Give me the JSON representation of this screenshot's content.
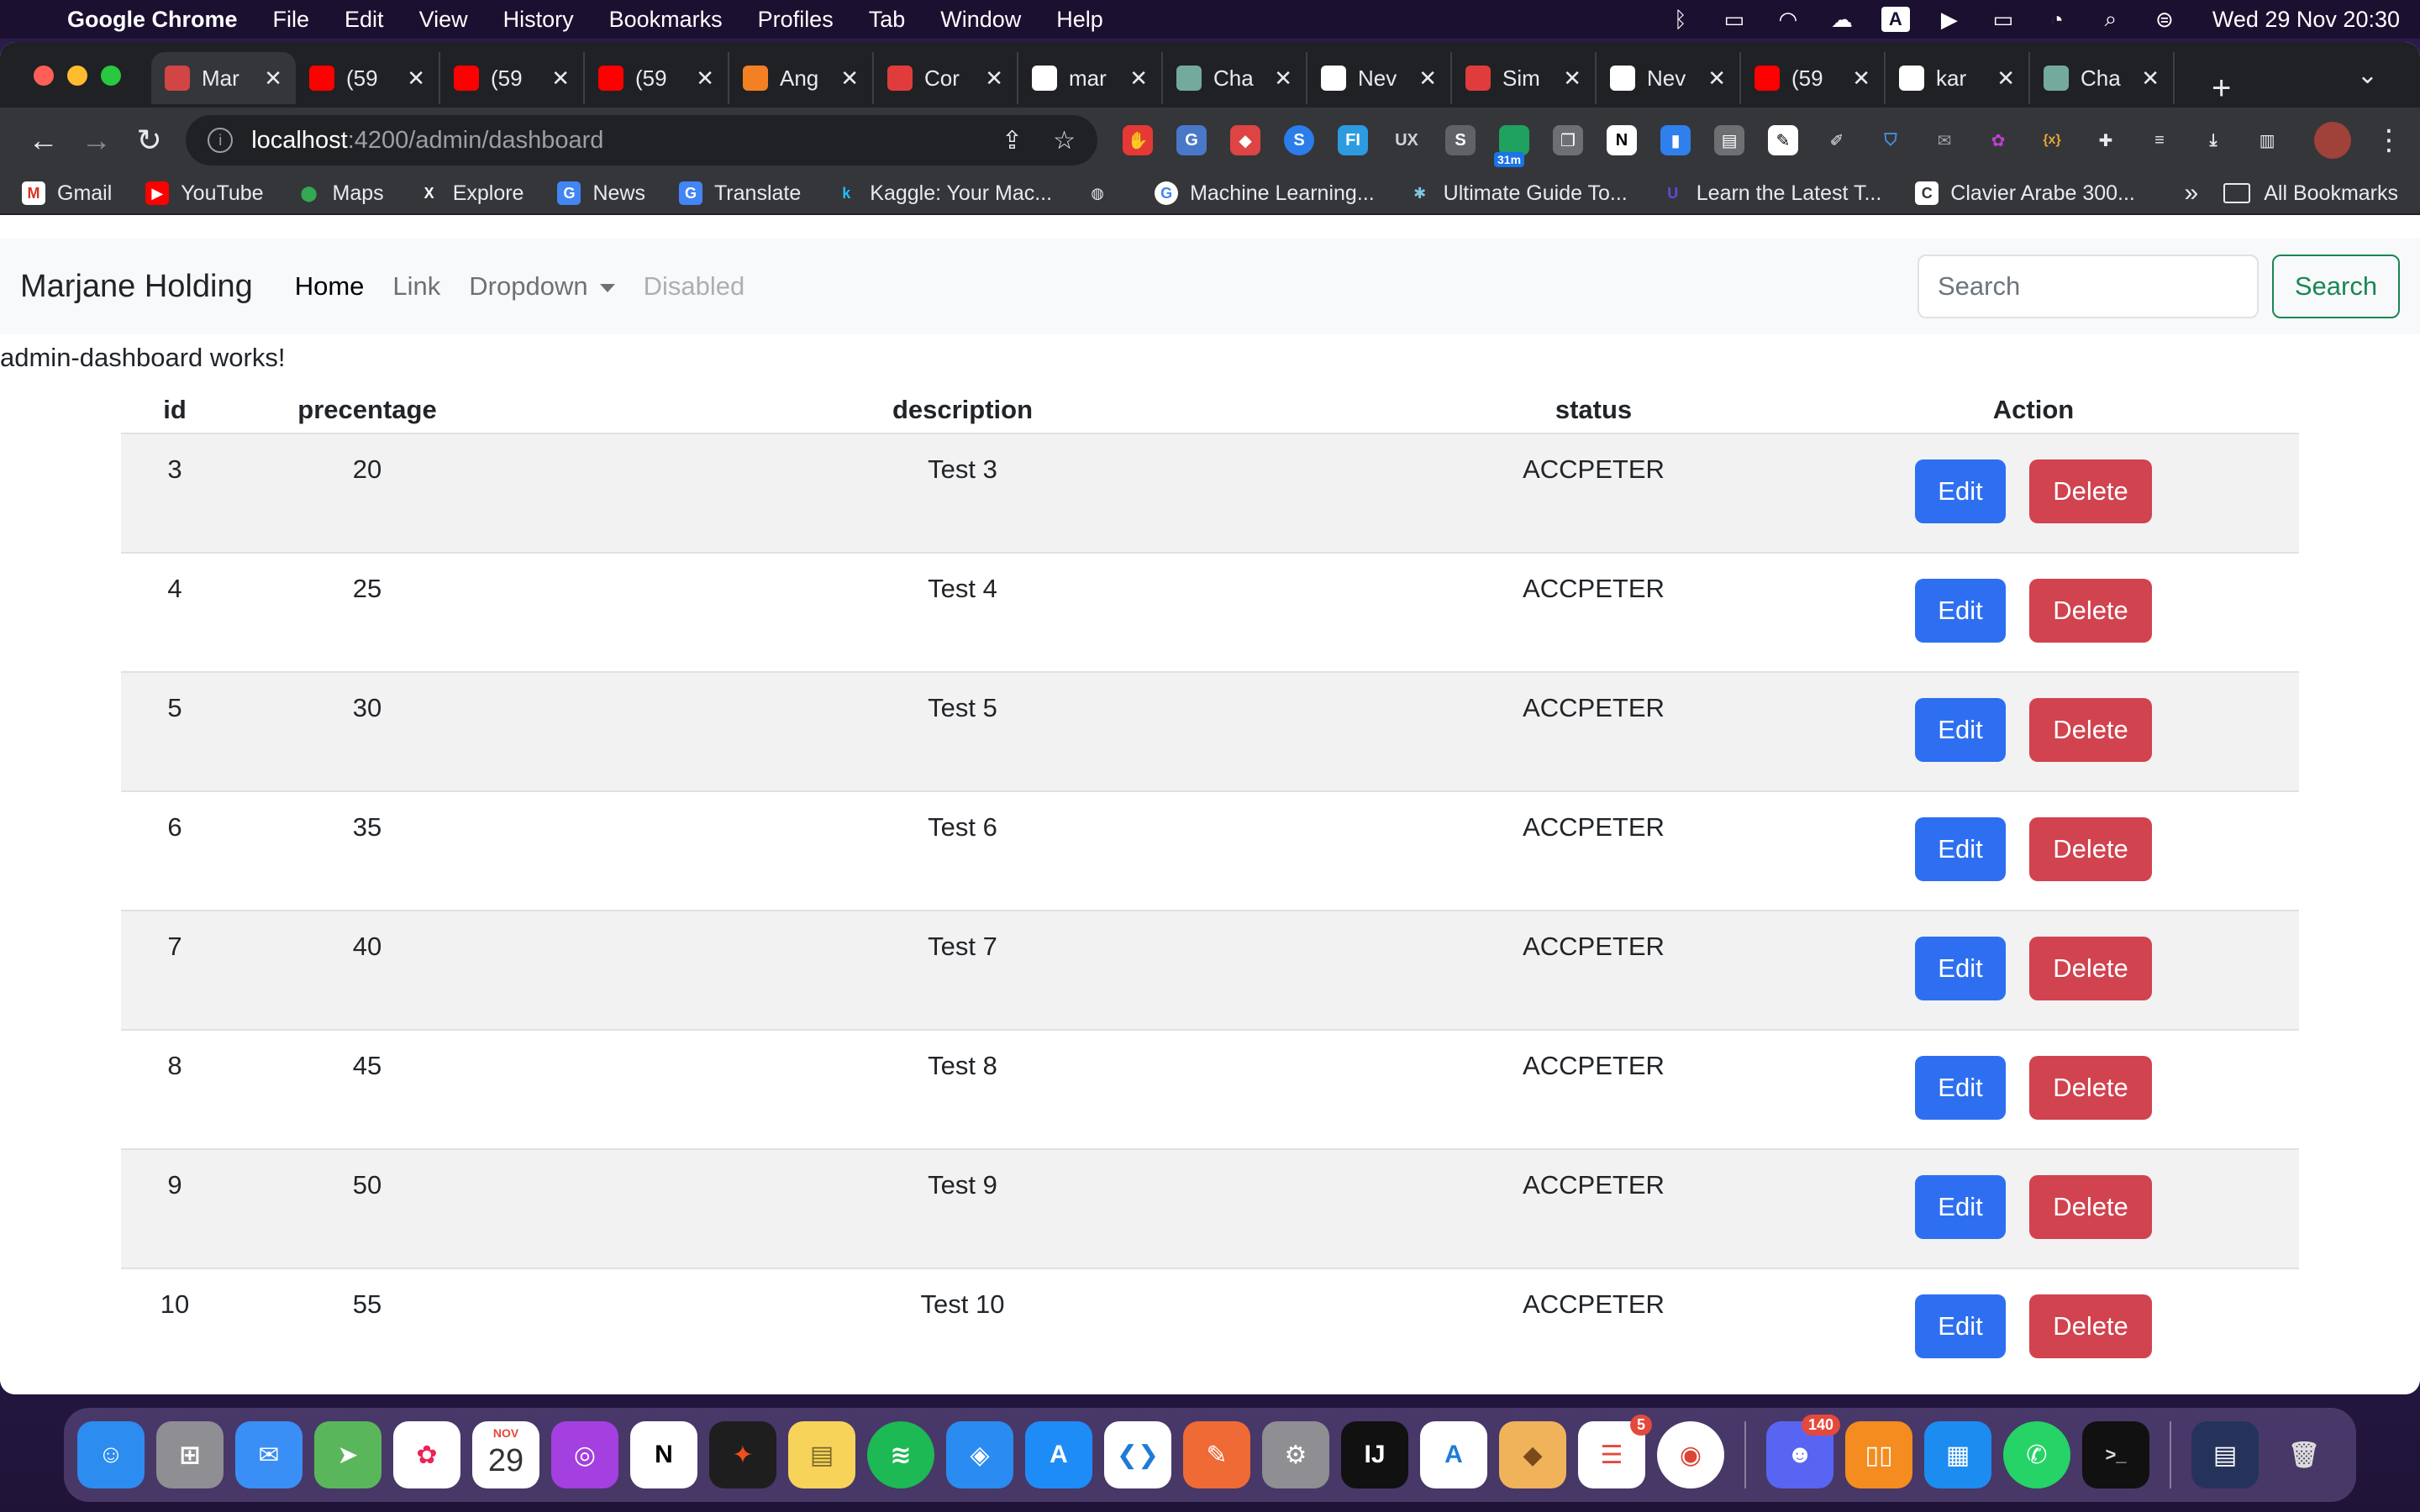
{
  "menubar": {
    "app_name": "Google Chrome",
    "items": [
      "File",
      "Edit",
      "View",
      "History",
      "Bookmarks",
      "Profiles",
      "Tab",
      "Window",
      "Help"
    ],
    "clock": "Wed 29 Nov  20:30",
    "input_source": "A"
  },
  "tabs": [
    {
      "title": "Mar",
      "active": true
    },
    {
      "title": "(59",
      "active": false
    },
    {
      "title": "(59",
      "active": false
    },
    {
      "title": "(59",
      "active": false
    },
    {
      "title": "Ang",
      "active": false
    },
    {
      "title": "Cor",
      "active": false
    },
    {
      "title": "mar",
      "active": false
    },
    {
      "title": "Cha",
      "active": false
    },
    {
      "title": "Nev",
      "active": false
    },
    {
      "title": "Sim",
      "active": false
    },
    {
      "title": "Nev",
      "active": false
    },
    {
      "title": "(59",
      "active": false
    },
    {
      "title": "kar",
      "active": false
    },
    {
      "title": "Cha",
      "active": false
    }
  ],
  "omnibox": {
    "host": "localhost",
    "path": ":4200/admin/dashboard"
  },
  "extension_badge": "31m",
  "bookmarks": [
    "Gmail",
    "YouTube",
    "Maps",
    "Explore",
    "News",
    "Translate",
    "Kaggle: Your Mac...",
    "",
    "Machine Learning...",
    "Ultimate Guide To...",
    "Learn the Latest T...",
    "Clavier Arabe 300..."
  ],
  "bookmarks_more": "»",
  "all_bookmarks": "All Bookmarks",
  "app": {
    "brand": "Marjane Holding",
    "nav": {
      "home": "Home",
      "link": "Link",
      "dropdown": "Dropdown",
      "disabled": "Disabled"
    },
    "search": {
      "placeholder": "Search",
      "button": "Search"
    },
    "works_text": "admin-dashboard works!"
  },
  "table": {
    "headers": {
      "id": "id",
      "percentage": "precentage",
      "description": "description",
      "status": "status",
      "action": "Action"
    },
    "edit_label": "Edit",
    "delete_label": "Delete",
    "rows": [
      {
        "id": "3",
        "percentage": "20",
        "description": "Test 3",
        "status": "ACCPETER"
      },
      {
        "id": "4",
        "percentage": "25",
        "description": "Test 4",
        "status": "ACCPETER"
      },
      {
        "id": "5",
        "percentage": "30",
        "description": "Test 5",
        "status": "ACCPETER"
      },
      {
        "id": "6",
        "percentage": "35",
        "description": "Test 6",
        "status": "ACCPETER"
      },
      {
        "id": "7",
        "percentage": "40",
        "description": "Test 7",
        "status": "ACCPETER"
      },
      {
        "id": "8",
        "percentage": "45",
        "description": "Test 8",
        "status": "ACCPETER"
      },
      {
        "id": "9",
        "percentage": "50",
        "description": "Test 9",
        "status": "ACCPETER"
      },
      {
        "id": "10",
        "percentage": "55",
        "description": "Test 10",
        "status": "ACCPETER"
      }
    ]
  },
  "dock": {
    "calendar_month": "NOV",
    "calendar_day": "29",
    "reminders_badge": "5",
    "discord_badge": "140"
  },
  "colors": {
    "edit_button": "#2d6ff0",
    "delete_button": "#d1434f",
    "search_outline": "#198754",
    "chrome_dark": "#35363a"
  }
}
